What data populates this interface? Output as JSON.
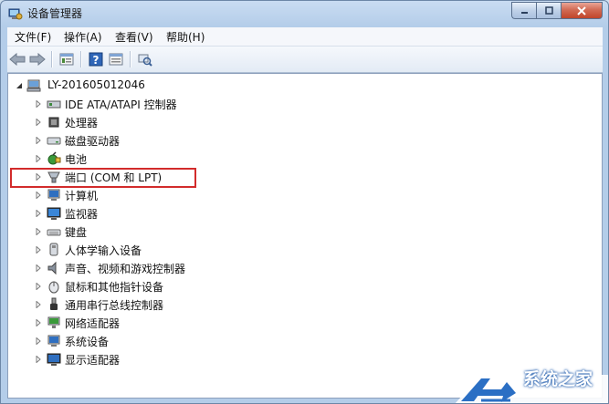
{
  "window": {
    "title": "设备管理器"
  },
  "menus": [
    "文件(F)",
    "操作(A)",
    "查看(V)",
    "帮助(H)"
  ],
  "toolbar": {
    "buttons": [
      "back-icon",
      "forward-icon",
      "properties-icon",
      "help-icon",
      "show-hidden-icon",
      "scan-hardware-icon"
    ]
  },
  "tree": {
    "root": "LY-201605012046",
    "items": [
      {
        "label": "IDE ATA/ATAPI 控制器",
        "icon": "ide-controller-icon"
      },
      {
        "label": "处理器",
        "icon": "processor-icon"
      },
      {
        "label": "磁盘驱动器",
        "icon": "disk-drive-icon"
      },
      {
        "label": "电池",
        "icon": "battery-icon"
      },
      {
        "label": "端口 (COM 和 LPT)",
        "icon": "port-icon",
        "highlighted": true
      },
      {
        "label": "计算机",
        "icon": "computer-icon"
      },
      {
        "label": "监视器",
        "icon": "monitor-icon"
      },
      {
        "label": "键盘",
        "icon": "keyboard-icon"
      },
      {
        "label": "人体学输入设备",
        "icon": "hid-icon"
      },
      {
        "label": "声音、视频和游戏控制器",
        "icon": "sound-icon"
      },
      {
        "label": "鼠标和其他指针设备",
        "icon": "mouse-icon"
      },
      {
        "label": "通用串行总线控制器",
        "icon": "usb-icon"
      },
      {
        "label": "网络适配器",
        "icon": "network-icon"
      },
      {
        "label": "系统设备",
        "icon": "system-icon"
      },
      {
        "label": "显示适配器",
        "icon": "display-adapter-icon"
      }
    ]
  },
  "watermark": {
    "text": "系统之家"
  },
  "colors": {
    "highlight_box": "#d22b2b",
    "titlebar": "#c9dcf2",
    "close_button": "#c0452a"
  }
}
